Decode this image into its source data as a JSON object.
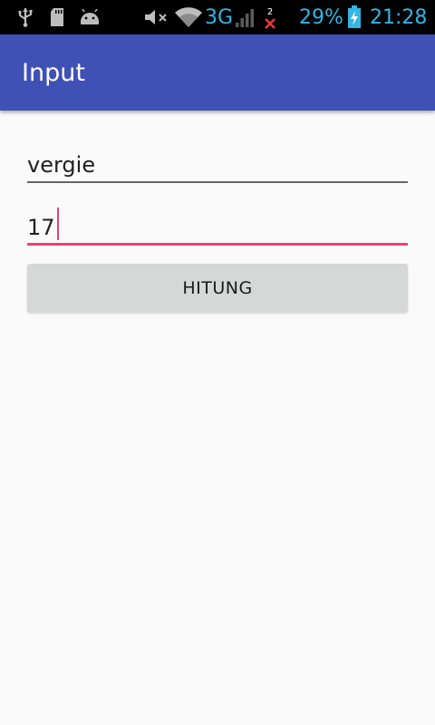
{
  "status_bar": {
    "battery": "29%",
    "time": "21:28",
    "network": "3G",
    "badge": "2",
    "icons": [
      "usb-icon",
      "sd-card-icon",
      "android-icon",
      "mute-icon",
      "wifi-icon",
      "signal-icon",
      "no-signal-icon",
      "battery-charging-icon"
    ],
    "accent_color": "#33b5e5"
  },
  "app_bar": {
    "title": "Input",
    "color": "#3f51b5"
  },
  "form": {
    "name_value": "vergie",
    "age_value": "17",
    "submit_label": "HITUNG",
    "focus_color": "#ec407a"
  }
}
